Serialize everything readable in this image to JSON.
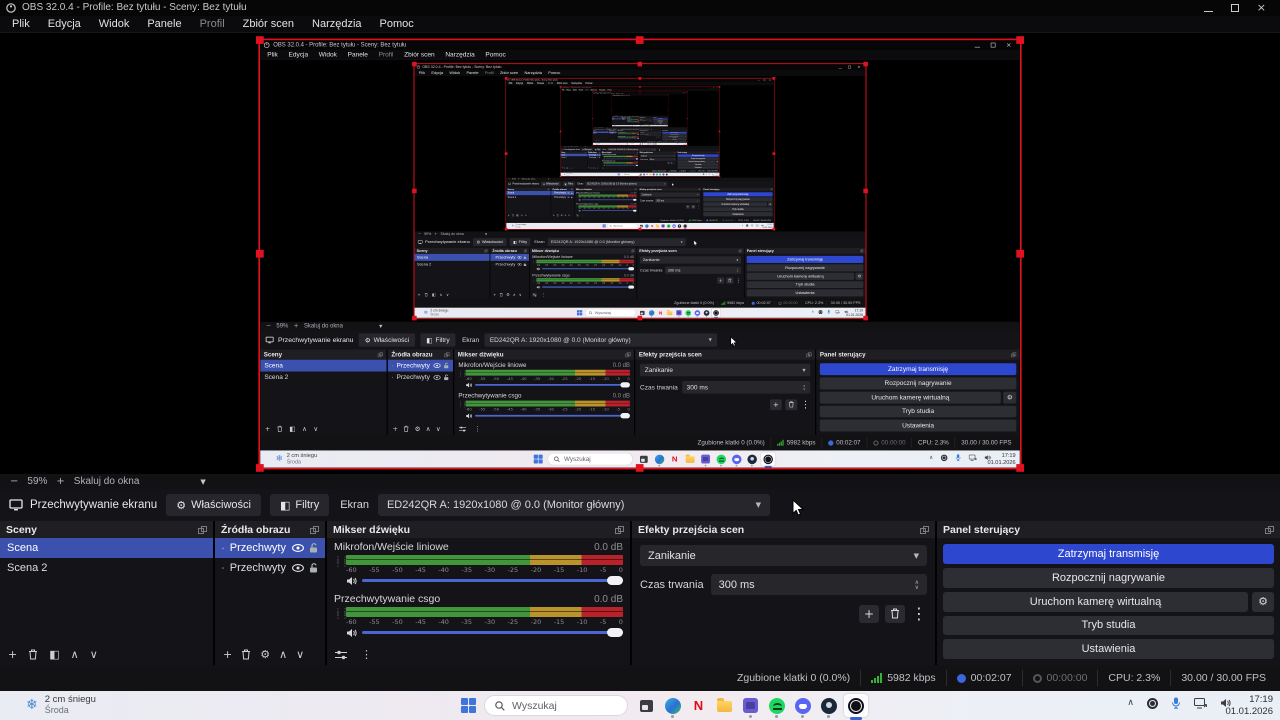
{
  "window": {
    "title": "OBS 32.0.4 - Profile: Bez tytułu - Sceny: Bez tytułu"
  },
  "menu": {
    "items": [
      "Plik",
      "Edycja",
      "Widok",
      "Panele",
      "Profil",
      "Zbiór scen",
      "Narzędzia",
      "Pomoc"
    ]
  },
  "preview": {
    "zoom_out": "−",
    "zoom_value": "59%",
    "zoom_in": "+",
    "fit_label": "Skaluj do okna"
  },
  "source_toolbar": {
    "source_name": "Przechwytywanie ekranu",
    "properties_label": "Właściwości",
    "filters_label": "Filtry",
    "screen_label": "Ekran",
    "screen_value": "ED242QR A: 1920x1080 @ 0.0 (Monitor główny)"
  },
  "docks": {
    "scenes": {
      "title": "Sceny",
      "items": [
        "Scena",
        "Scena 2"
      ]
    },
    "sources": {
      "title": "Źródła obrazu",
      "items": [
        "Przechwyty",
        "Przechwyty"
      ]
    },
    "mixer": {
      "title": "Mikser dźwięku",
      "tracks": [
        {
          "name": "Mikrofon/Wejście liniowe",
          "level": "0.0 dB"
        },
        {
          "name": "Przechwytywanie csgo",
          "level": "0.0 dB"
        }
      ],
      "scale": [
        "-60",
        "-55",
        "-50",
        "-45",
        "-40",
        "-35",
        "-30",
        "-25",
        "-20",
        "-15",
        "-10",
        "-5",
        "0"
      ]
    },
    "transitions": {
      "title": "Efekty przejścia scen",
      "transition": "Zanikanie",
      "duration_label": "Czas trwania",
      "duration_value": "300 ms"
    },
    "controls": {
      "title": "Panel sterujący",
      "stop_streaming": "Zatrzymaj transmisję",
      "start_recording": "Rozpocznij nagrywanie",
      "virtual_camera": "Uruchom kamerę wirtualną",
      "studio_mode": "Tryb studia",
      "settings": "Ustawienia"
    }
  },
  "status_bar": {
    "dropped_frames": "Zgubione klatki 0 (0.0%)",
    "bitrate": "5982 kbps",
    "stream_time": "00:02:07",
    "record_time": "00:00:00",
    "cpu": "CPU: 2.3%",
    "fps": "30.00 / 30.00 FPS"
  },
  "taskbar": {
    "weather_line1": "2 cm śniegu",
    "weather_line2": "Środa",
    "search_placeholder": "Wyszukaj",
    "netflix_letter": "N",
    "clock_time": "17:19",
    "clock_date": "01.01.2026"
  },
  "colors": {
    "capture_border": "#e0121f",
    "selection_blue": "#3b51ad",
    "accent_blue": "#2e47cf",
    "meter_green": "#43953c",
    "meter_yellow": "#b9932b",
    "meter_red": "#b8232b"
  }
}
